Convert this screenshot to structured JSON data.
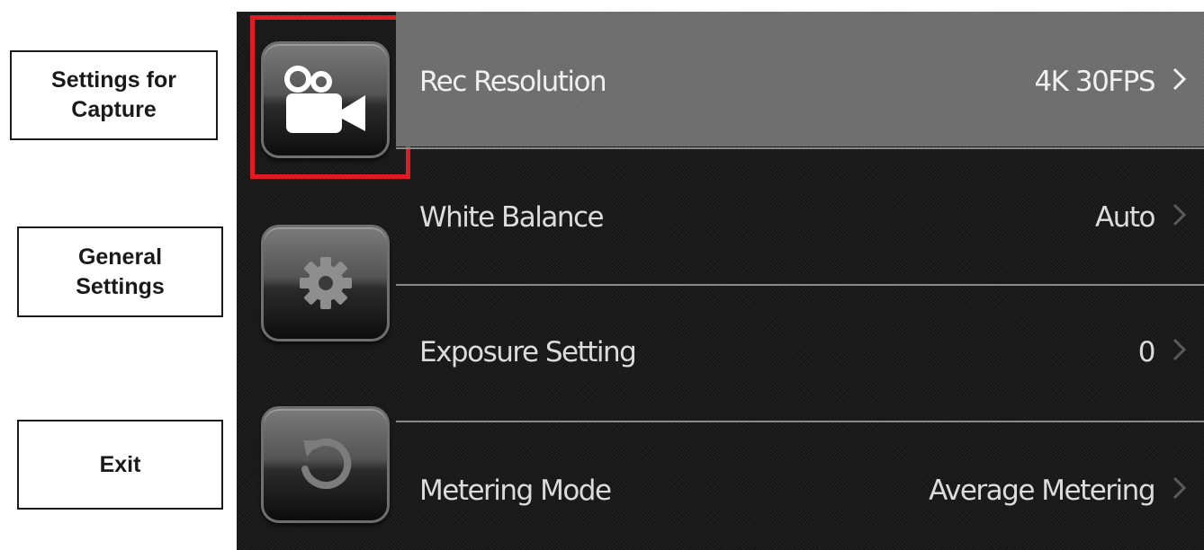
{
  "callouts": {
    "capture": "Settings for\nCapture",
    "general": "General\nSettings",
    "exit": "Exit"
  },
  "sidebar": {
    "buttons": [
      {
        "name": "capture",
        "icon": "video-camera-icon",
        "selected": true
      },
      {
        "name": "general",
        "icon": "gear-icon",
        "selected": false
      },
      {
        "name": "exit",
        "icon": "return-arrow-icon",
        "selected": false
      }
    ]
  },
  "menu": {
    "rows": [
      {
        "label": "Rec Resolution",
        "value": "4K 30FPS",
        "selected": true
      },
      {
        "label": "White Balance",
        "value": "Auto",
        "selected": false
      },
      {
        "label": "Exposure Setting",
        "value": "0",
        "selected": false
      },
      {
        "label": "Metering Mode",
        "value": "Average Metering",
        "selected": false
      }
    ]
  },
  "colors": {
    "highlight": "#e01b24",
    "screen_bg": "#1a1a1a",
    "selected_row": "#6c6c6c",
    "text": "#dcdcdc"
  }
}
